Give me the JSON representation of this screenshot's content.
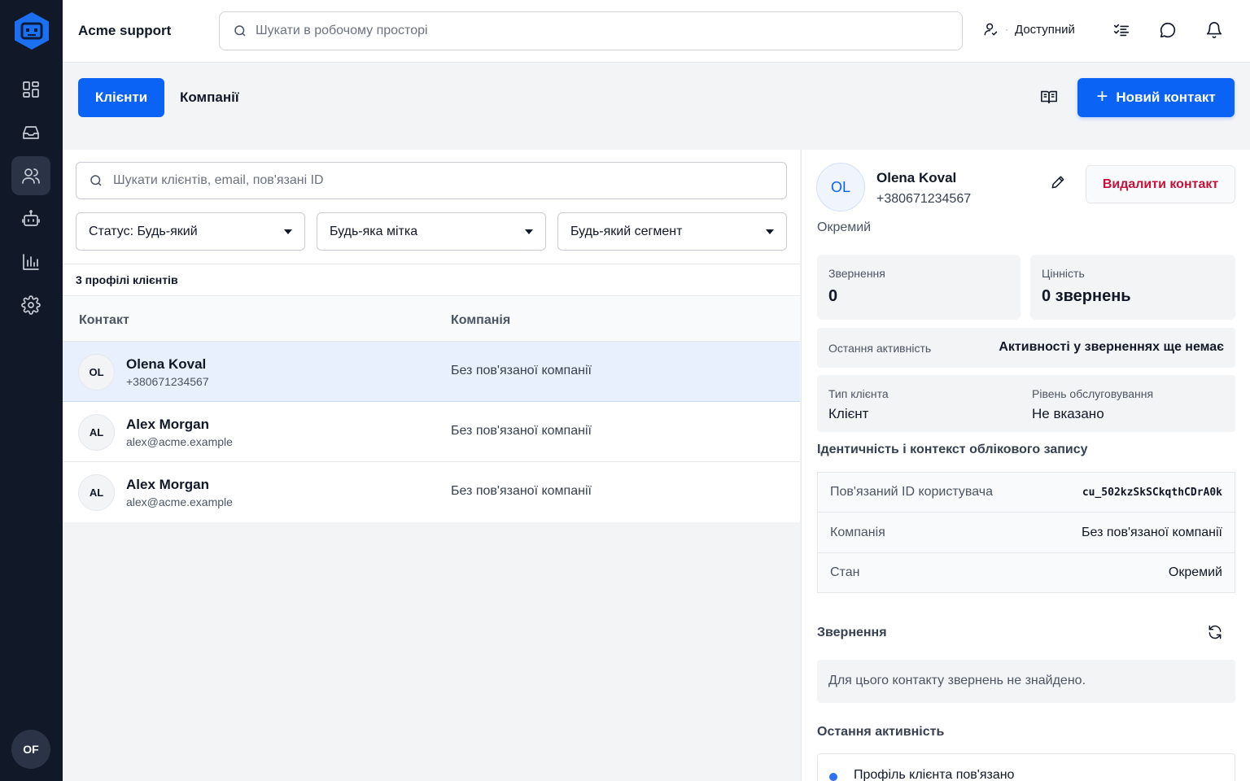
{
  "app": {
    "title": "Acme support"
  },
  "global_search": {
    "placeholder": "Шукати в робочому просторі"
  },
  "presence": {
    "label": "Доступний"
  },
  "user": {
    "initials": "OF"
  },
  "tabs": {
    "clients": "Клієнти",
    "companies": "Компанії"
  },
  "actions": {
    "new_contact": "Новий контакт"
  },
  "list": {
    "search_placeholder": "Шукати клієнтів, email, пов'язані ID",
    "filters": {
      "status": "Статус: Будь-який",
      "tag": "Будь-яка мітка",
      "segment": "Будь-який сегмент"
    },
    "count_text": "3 профілі клієнтів",
    "columns": {
      "contact": "Контакт",
      "company": "Компанія"
    },
    "rows": [
      {
        "initials": "OL",
        "name": "Olena Koval",
        "sub": "+380671234567",
        "company": "Без пов'язаної компанії"
      },
      {
        "initials": "AL",
        "name": "Alex Morgan",
        "sub": "alex@acme.example",
        "company": "Без пов'язаної компанії"
      },
      {
        "initials": "AL",
        "name": "Alex Morgan",
        "sub": "alex@acme.example",
        "company": "Без пов'язаної компанії"
      }
    ]
  },
  "detail": {
    "initials": "OL",
    "name": "Olena Koval",
    "phone": "+380671234567",
    "delete_label": "Видалити контакт",
    "kind": "Окремий",
    "stats": {
      "requests_label": "Звернення",
      "requests_value": "0",
      "value_label": "Цінність",
      "value_value": "0 звернень"
    },
    "last_activity": {
      "label": "Остання активність",
      "value": "Активності у зверненнях ще немає"
    },
    "client_type": {
      "label": "Тип клієнта",
      "value": "Клієнт"
    },
    "service_level": {
      "label": "Рівень обслуговування",
      "value": "Не вказано"
    },
    "identity_title": "Ідентичність і контекст облікового запису",
    "identity": [
      {
        "key": "Пов'язаний ID користувача",
        "value": "cu_502kzSkSCkqthCDrA0k"
      },
      {
        "key": "Компанія",
        "value": "Без пов'язаної компанії"
      },
      {
        "key": "Стан",
        "value": "Окремий"
      }
    ],
    "requests_title": "Звернення",
    "requests_empty": "Для цього контакту звернень не знайдено.",
    "activity_title": "Остання активність",
    "activity_items": [
      {
        "text": "Профіль клієнта пов'язано"
      }
    ]
  }
}
